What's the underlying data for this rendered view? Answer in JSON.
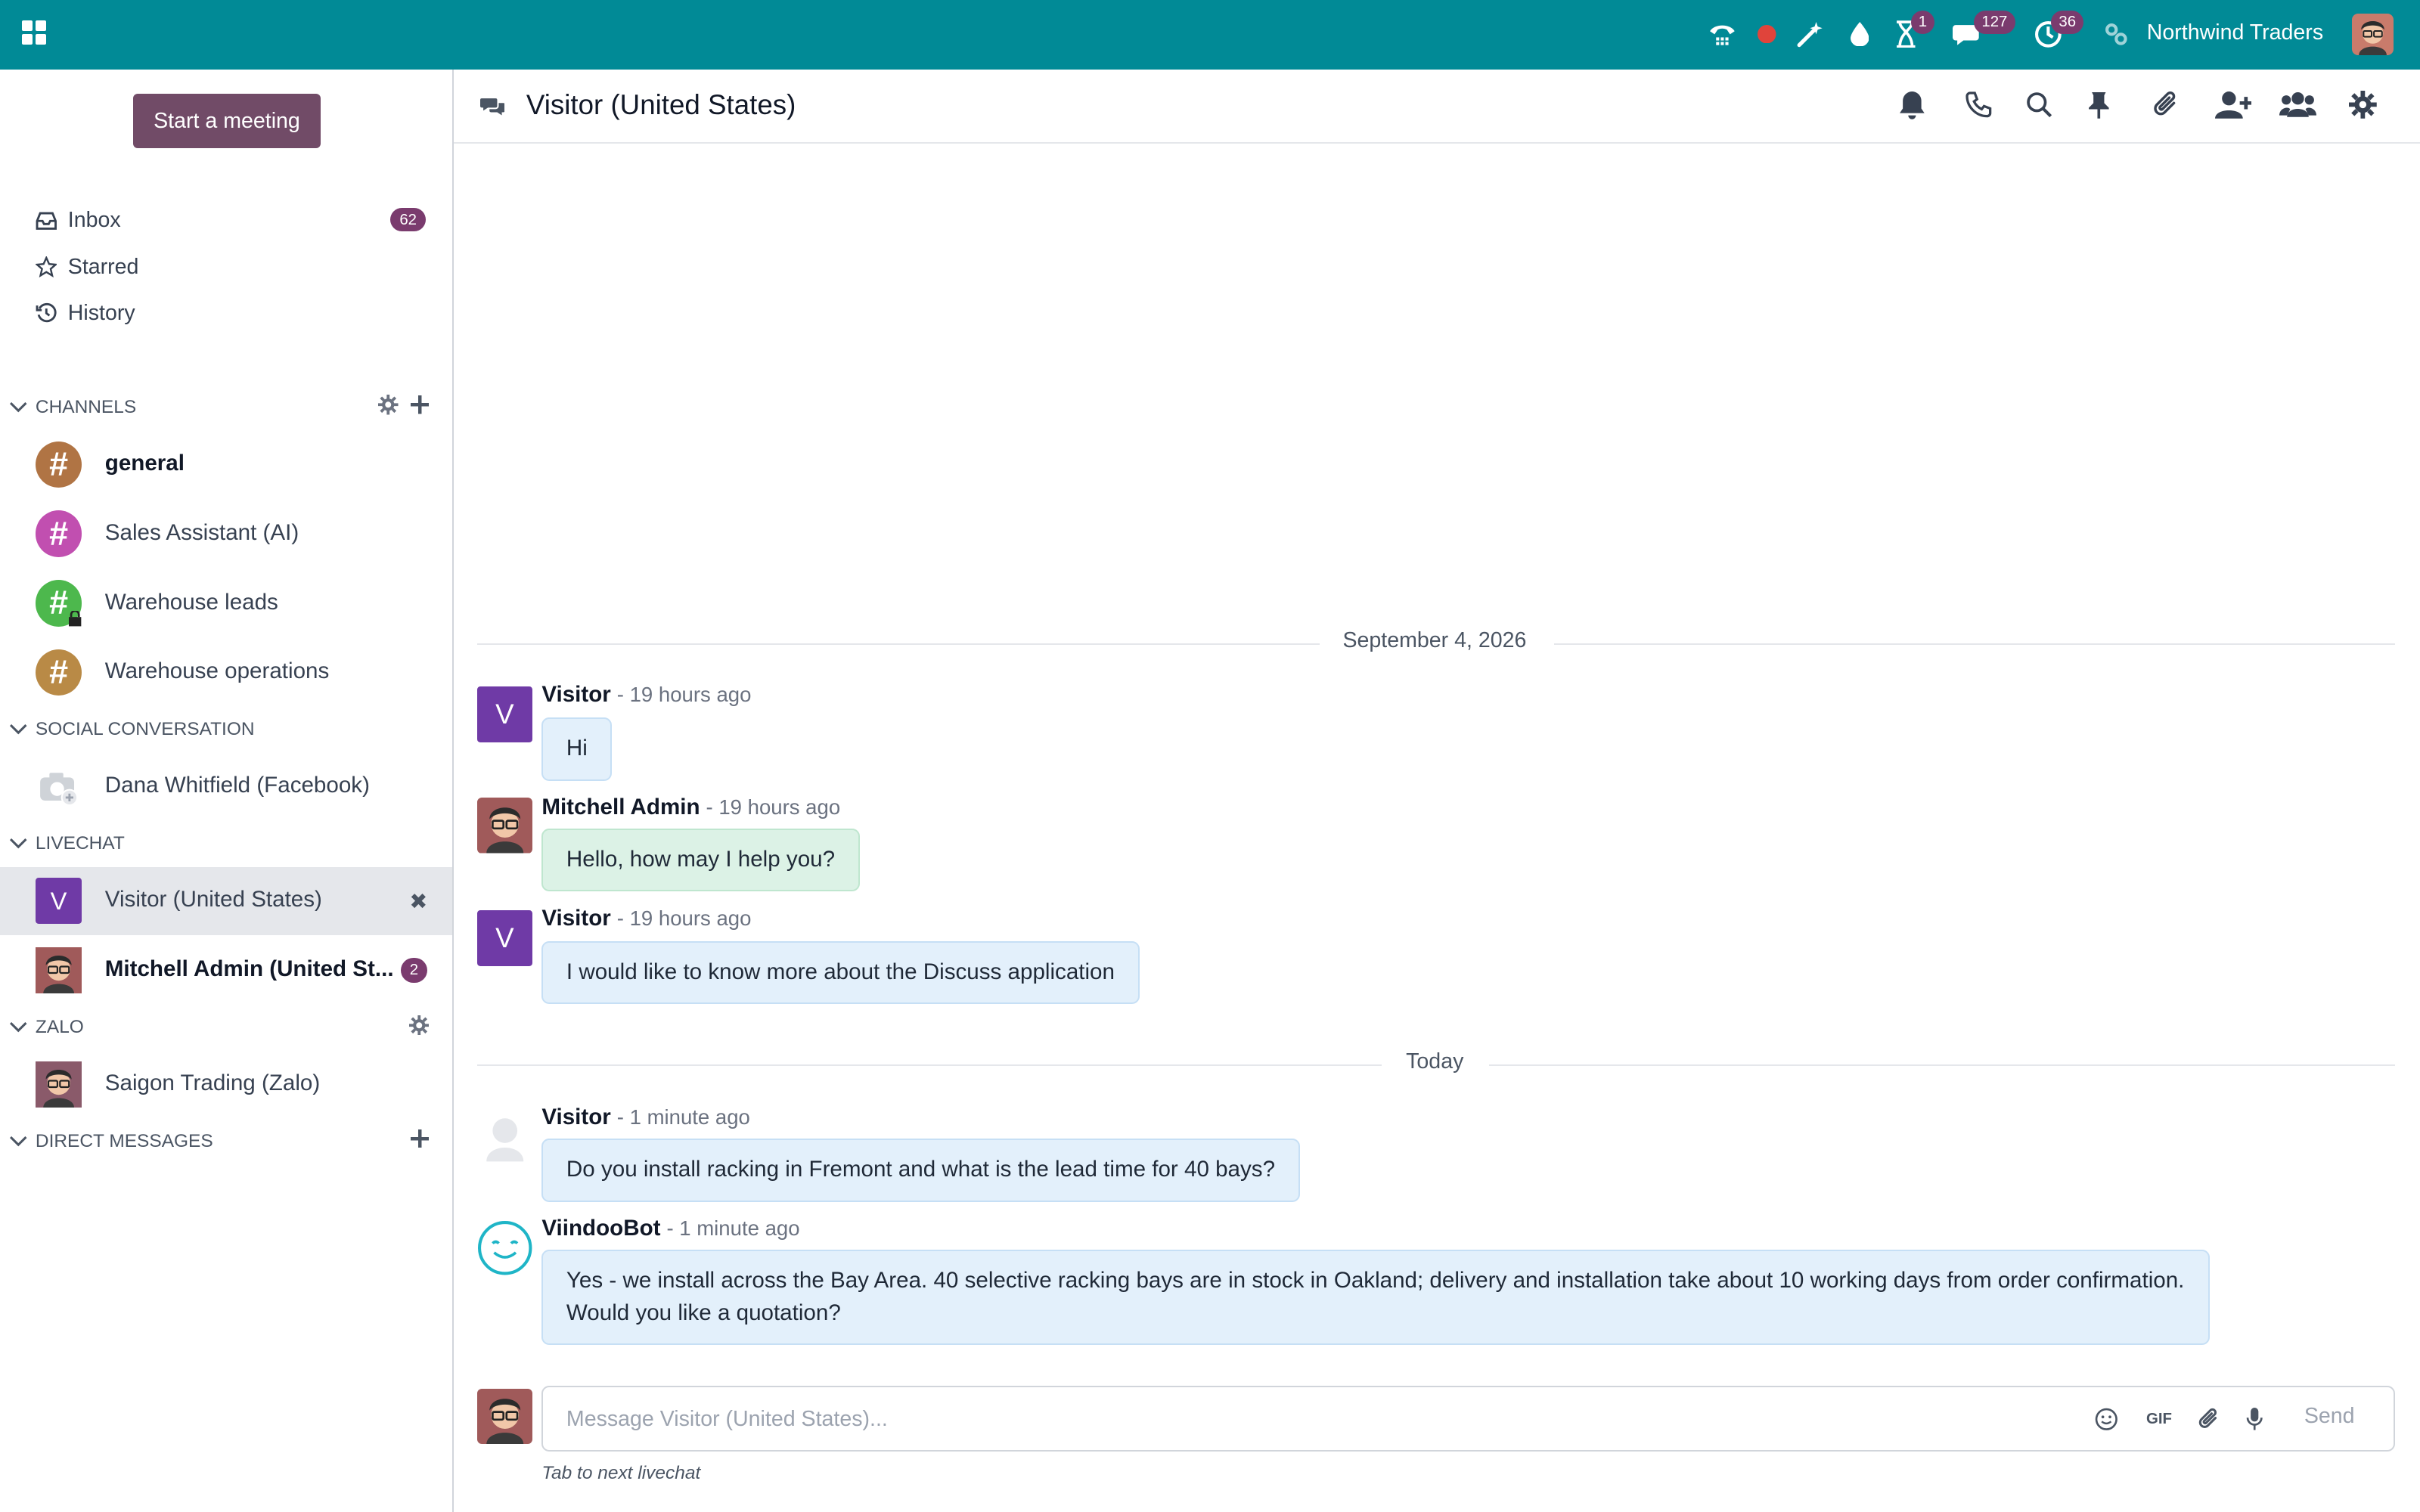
{
  "topbar": {
    "company": "Northwind Traders",
    "activity_badge": "1",
    "messages_badge": "127",
    "clock_badge": "36",
    "accent": "#018a96"
  },
  "sidebar": {
    "meeting_button": "Start a meeting",
    "nav": [
      {
        "label": "Inbox",
        "icon": "inbox-icon",
        "count": "62"
      },
      {
        "label": "Starred",
        "icon": "star-icon"
      },
      {
        "label": "History",
        "icon": "history-icon"
      }
    ],
    "channels_header": "CHANNELS",
    "channels": [
      {
        "name": "general",
        "color": "#b07444"
      },
      {
        "name": "Sales Assistant (AI)",
        "color": "#c14fb0"
      },
      {
        "name": "Warehouse leads",
        "color": "#4db84d"
      },
      {
        "name": "Warehouse operations",
        "color": "#b98a46"
      }
    ],
    "social_header": "SOCIAL CONVERSATION",
    "social": [
      {
        "name": "Dana Whitfield (Facebook)"
      }
    ],
    "livechat_header": "LIVECHAT",
    "livechat": [
      {
        "name": "Visitor (United States)",
        "avatar_letter": "V"
      },
      {
        "name": "Mitchell Admin (United St...",
        "unread": "2"
      }
    ],
    "zalo_header": "ZALO",
    "zalo": [
      {
        "name": "Saigon Trading (Zalo)"
      }
    ],
    "dm_header": "DIRECT MESSAGES"
  },
  "thread": {
    "title": "Visitor (United States)",
    "separators": [
      "September 4, 2026",
      "Today"
    ],
    "messages": [
      {
        "author": "Visitor",
        "time": "- 19 hours ago",
        "text": "Hi",
        "avatar_letter": "V"
      },
      {
        "author": "Mitchell Admin",
        "time": "- 19 hours ago",
        "text": "Hello, how may I help you?"
      },
      {
        "author": "Visitor",
        "time": "- 19 hours ago",
        "text": "I would like to know more about the Discuss application",
        "avatar_letter": "V"
      },
      {
        "author": "Visitor",
        "time": "- 1 minute ago",
        "text": "Do you install racking in Fremont and what is the lead time for 40 bays?"
      },
      {
        "author": "ViindooBot",
        "time": "- 1 minute ago",
        "text": "Yes - we install across the Bay Area. 40 selective racking bays are in stock in Oakland; delivery and installation take about 10 working days from order confirmation. Would you like a quotation?"
      }
    ]
  },
  "composer": {
    "placeholder": "Message Visitor (United States)...",
    "gif_label": "GIF",
    "send_label": "Send",
    "hint": "Tab to next livechat"
  }
}
